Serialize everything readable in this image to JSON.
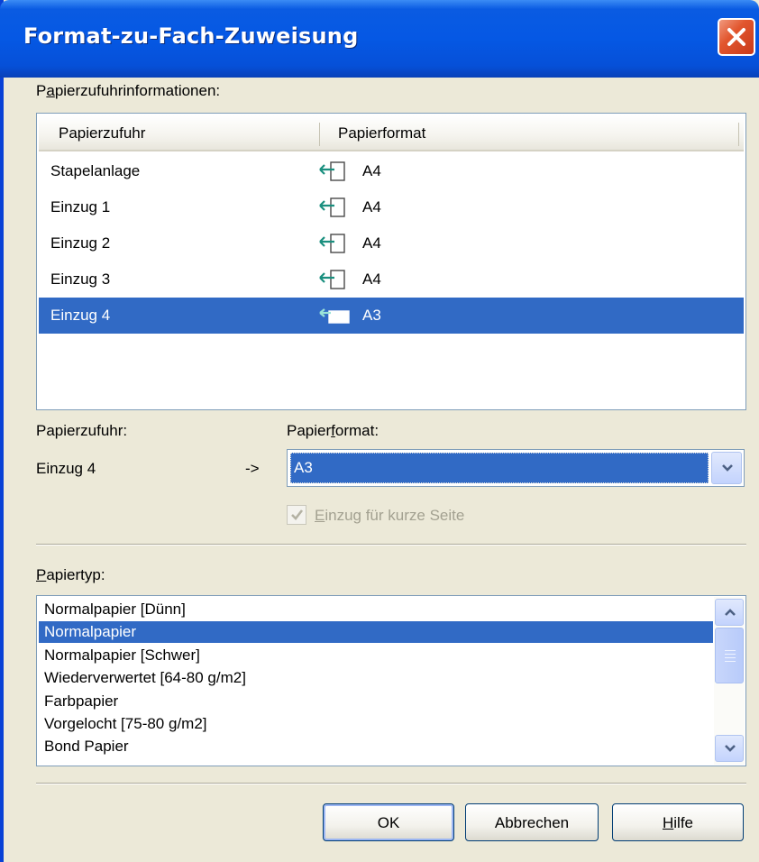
{
  "window": {
    "title": "Format-zu-Fach-Zuweisung",
    "close_icon": "close-icon"
  },
  "paper_source_info": {
    "label": "Papierzufuhrinformationen:",
    "columns": [
      "Papierzufuhr",
      "Papierformat"
    ],
    "rows": [
      {
        "source": "Stapelanlage",
        "format": "A4",
        "feed_icon": "portrait-feed-icon",
        "selected": false
      },
      {
        "source": "Einzug 1",
        "format": "A4",
        "feed_icon": "portrait-feed-icon",
        "selected": false
      },
      {
        "source": "Einzug 2",
        "format": "A4",
        "feed_icon": "portrait-feed-icon",
        "selected": false
      },
      {
        "source": "Einzug 3",
        "format": "A4",
        "feed_icon": "portrait-feed-icon",
        "selected": false
      },
      {
        "source": "Einzug 4",
        "format": "A3",
        "feed_icon": "landscape-feed-icon",
        "selected": true
      }
    ]
  },
  "assignment": {
    "source_label": "Papierzufuhr:",
    "source_value": "Einzug 4",
    "arrow": "->",
    "format_label": "Papierformat:",
    "format_value": "A3",
    "short_edge_label": "Einzug für kurze Seite",
    "short_edge_checked": true,
    "short_edge_disabled": true
  },
  "paper_type": {
    "label": "Papiertyp:",
    "items": [
      "Normalpapier [Dünn]",
      "Normalpapier",
      "Normalpapier [Schwer]",
      "Wiederverwertet [64-80 g/m2]",
      "Farbpapier",
      "Vorgelocht [75-80 g/m2]",
      "Bond Papier"
    ],
    "selected": "Normalpapier"
  },
  "buttons": {
    "ok": "OK",
    "cancel": "Abbrechen",
    "help": "Hilfe"
  },
  "colors": {
    "titlebar": "#0558e4",
    "selection": "#316ac5",
    "dialog_bg": "#ece9d8"
  }
}
